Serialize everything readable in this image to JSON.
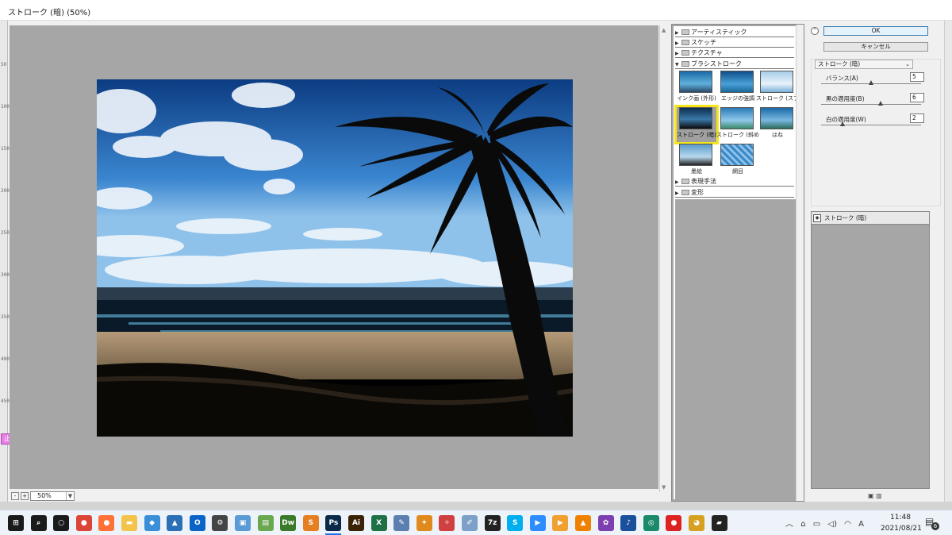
{
  "window": {
    "title": "ストローク (暗) (50%)"
  },
  "ruler": {
    "marks": [
      "50",
      "100",
      "150",
      "200",
      "250",
      "300",
      "350",
      "400",
      "450"
    ]
  },
  "tool_badge": "止",
  "zoom": {
    "minus": "-",
    "plus": "+",
    "value": "50%"
  },
  "gallery": {
    "categories": [
      {
        "label": "アーティスティック",
        "expanded": false
      },
      {
        "label": "スケッチ",
        "expanded": false
      },
      {
        "label": "テクスチャ",
        "expanded": false
      },
      {
        "label": "ブラシストローク",
        "expanded": true
      },
      {
        "label": "表現手法",
        "expanded": false
      },
      {
        "label": "変形",
        "expanded": false
      }
    ],
    "thumbs": [
      {
        "label": "インク画 (外形)"
      },
      {
        "label": "エッジの強調"
      },
      {
        "label": "ストローク (スプレー)"
      },
      {
        "label": "ストローク (暗)",
        "selected": true
      },
      {
        "label": "ストローク (斜め)"
      },
      {
        "label": "はね"
      },
      {
        "label": "墨絵"
      },
      {
        "label": "網目"
      }
    ]
  },
  "panel": {
    "ok": "OK",
    "cancel": "キャンセル",
    "filter_select": "ストローク (暗)",
    "params": [
      {
        "label": "バランス(A)",
        "value": "5",
        "level": 0.5
      },
      {
        "label": "黒の適用度(B)",
        "value": "6",
        "level": 0.6
      },
      {
        "label": "白の適用度(W)",
        "value": "2",
        "level": 0.2
      }
    ],
    "layer": "ストローク (暗)"
  },
  "taskbar": {
    "time": "11:48",
    "date": "2021/08/21",
    "ime": "A",
    "notifications": "6",
    "apps": [
      {
        "name": "windows-start",
        "glyph": "⊞",
        "color": "#1a1a1a"
      },
      {
        "name": "search",
        "glyph": "⌕",
        "color": "#1a1a1a"
      },
      {
        "name": "cortana",
        "glyph": "○",
        "color": "#1a1a1a"
      },
      {
        "name": "chrome",
        "glyph": "●",
        "color": "#db4437"
      },
      {
        "name": "firefox",
        "glyph": "●",
        "color": "#ff7139"
      },
      {
        "name": "explorer",
        "glyph": "▬",
        "color": "#f3c44c"
      },
      {
        "name": "app-blue",
        "glyph": "◆",
        "color": "#3a8fd8"
      },
      {
        "name": "photos",
        "glyph": "▲",
        "color": "#2b6fb6"
      },
      {
        "name": "outlook",
        "glyph": "O",
        "color": "#0a64c8"
      },
      {
        "name": "settings",
        "glyph": "⚙",
        "color": "#444"
      },
      {
        "name": "app-panel",
        "glyph": "▣",
        "color": "#5b9bd5"
      },
      {
        "name": "app-green",
        "glyph": "▤",
        "color": "#6aa84f"
      },
      {
        "name": "dreamweaver",
        "glyph": "Dw",
        "color": "#3a7a2a"
      },
      {
        "name": "app-orange",
        "glyph": "S",
        "color": "#e67e22"
      },
      {
        "name": "photoshop",
        "glyph": "Ps",
        "color": "#0b2a4a",
        "active": true
      },
      {
        "name": "illustrator",
        "glyph": "Ai",
        "color": "#3a2304"
      },
      {
        "name": "excel",
        "glyph": "X",
        "color": "#1e7145"
      },
      {
        "name": "app-pen",
        "glyph": "✎",
        "color": "#5b7fb0"
      },
      {
        "name": "butterfly",
        "glyph": "✦",
        "color": "#e08a1e"
      },
      {
        "name": "app-pin",
        "glyph": "✧",
        "color": "#d04040"
      },
      {
        "name": "app-draw",
        "glyph": "✐",
        "color": "#7da0c8"
      },
      {
        "name": "7zip",
        "glyph": "7z",
        "color": "#222"
      },
      {
        "name": "skype",
        "glyph": "S",
        "color": "#00aff0"
      },
      {
        "name": "zoom",
        "glyph": "▶",
        "color": "#2d8cff"
      },
      {
        "name": "media",
        "glyph": "▶",
        "color": "#f0a030"
      },
      {
        "name": "vlc",
        "glyph": "▲",
        "color": "#f08000"
      },
      {
        "name": "app-purple",
        "glyph": "✿",
        "color": "#7b3fb0"
      },
      {
        "name": "music",
        "glyph": "♪",
        "color": "#1a4f9c"
      },
      {
        "name": "app-globe",
        "glyph": "◎",
        "color": "#1a8a6a"
      },
      {
        "name": "record",
        "glyph": "●",
        "color": "#d22"
      },
      {
        "name": "app-char",
        "glyph": "◕",
        "color": "#d8a020"
      },
      {
        "name": "sticky",
        "glyph": "▰",
        "color": "#222"
      }
    ]
  }
}
